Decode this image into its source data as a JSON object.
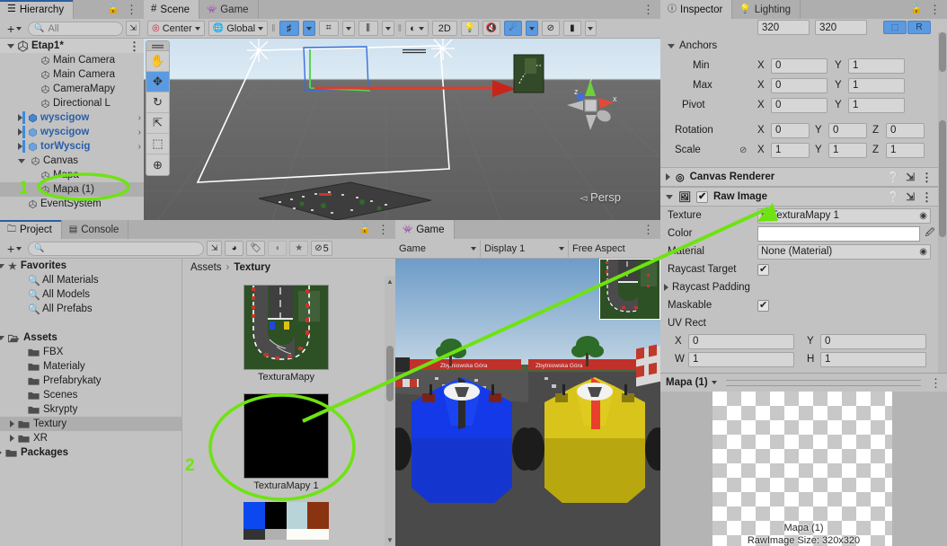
{
  "hierarchy": {
    "tab_label": "Hierarchy",
    "icons": {
      "tab": "hierarchy-icon",
      "lock": "lock-icon",
      "menu": "kebab-menu-icon",
      "add": "plus-icon",
      "search": "search-icon",
      "filter": "filter-icon"
    },
    "search_placeholder": "All",
    "scene_name": "Etap1*",
    "items": [
      {
        "label": "Main Camera",
        "indent": 2,
        "icon": "cube-icon",
        "expand": "none",
        "prefab": false,
        "blue": false,
        "selected": false,
        "strip": false
      },
      {
        "label": "Main Camera",
        "indent": 2,
        "icon": "cube-icon",
        "expand": "none",
        "prefab": false,
        "blue": false,
        "selected": false,
        "strip": false
      },
      {
        "label": "CameraMapy",
        "indent": 2,
        "icon": "cube-icon",
        "expand": "none",
        "prefab": false,
        "blue": false,
        "selected": false,
        "strip": false
      },
      {
        "label": "Directional L",
        "indent": 2,
        "icon": "cube-icon",
        "expand": "none",
        "prefab": false,
        "blue": false,
        "selected": false,
        "strip": false
      },
      {
        "label": "wyscigow",
        "indent": 1,
        "icon": "prefab-cube-icon",
        "expand": "collapsed",
        "prefab": true,
        "blue": true,
        "selected": false,
        "strip": true
      },
      {
        "label": "wyscigow",
        "indent": 1,
        "icon": "prefab-variant-icon",
        "expand": "collapsed",
        "prefab": true,
        "blue": true,
        "selected": false,
        "strip": true
      },
      {
        "label": "torWyscig",
        "indent": 1,
        "icon": "prefab-variant-icon",
        "expand": "collapsed",
        "prefab": true,
        "blue": true,
        "selected": false,
        "strip": true
      },
      {
        "label": "Canvas",
        "indent": 1,
        "icon": "cube-icon",
        "expand": "expanded",
        "prefab": false,
        "blue": false,
        "selected": false,
        "strip": false
      },
      {
        "label": "Mapa",
        "indent": 2,
        "icon": "cube-icon",
        "expand": "none",
        "prefab": false,
        "blue": false,
        "selected": false,
        "strip": false
      },
      {
        "label": "Mapa (1)",
        "indent": 2,
        "icon": "cube-icon",
        "expand": "none",
        "prefab": false,
        "blue": false,
        "selected": true,
        "strip": false
      },
      {
        "label": "EventSystem",
        "indent": 1,
        "icon": "cube-icon",
        "expand": "none",
        "prefab": false,
        "blue": false,
        "selected": false,
        "strip": false
      }
    ]
  },
  "scene": {
    "tabs": [
      {
        "label": "Scene",
        "icon": "grid-hash-icon",
        "active": true
      },
      {
        "label": "Game",
        "icon": "gamepad-icon",
        "active": false
      }
    ],
    "toolbar": {
      "pivot_label": "Center",
      "pivot_icon": "pivot-center-icon",
      "space_label": "Global",
      "space_icon": "globe-icon",
      "grid_icon": "grid-axis-y-icon",
      "snap_icon": "grid-snap-icon",
      "ruler_icon": "ruler-icon",
      "shading_icon": "shading-sphere-icon",
      "toggle_2d_label": "2D",
      "light_icon": "light-off-icon",
      "audio_icon": "audio-mute-icon",
      "fx_icon": "effects-icon",
      "hidden_icon": "visibility-off-icon",
      "camera_icon": "scene-camera-icon",
      "grid_active": true,
      "fx_active": true
    },
    "tools": [
      {
        "name": "hand-tool",
        "icon": "hand-icon",
        "active": false
      },
      {
        "name": "move-tool",
        "icon": "move-icon",
        "active": true
      },
      {
        "name": "rotate-tool",
        "icon": "rotate-icon",
        "active": false
      },
      {
        "name": "scale-tool",
        "icon": "scale-icon",
        "active": false
      },
      {
        "name": "rect-tool",
        "icon": "rect-icon",
        "active": false
      },
      {
        "name": "transform-tool",
        "icon": "transform-icon",
        "active": false
      }
    ],
    "gizmo": {
      "x_label": "x",
      "y_label": "y",
      "z_label": "z"
    },
    "projection_label": "Persp"
  },
  "project": {
    "tabs": [
      {
        "label": "Project",
        "icon": "folder-icon",
        "active": true
      },
      {
        "label": "Console",
        "icon": "console-icon",
        "active": false
      }
    ],
    "icons": {
      "lock": "lock-icon",
      "menu": "kebab-menu-icon",
      "add": "plus-icon",
      "search": "search-icon",
      "save_search": "save-search-icon",
      "packages": "package-filter-icon",
      "label": "label-filter-icon",
      "type": "type-filter-icon",
      "favorite": "star-icon",
      "hidden": "visibility-off-icon"
    },
    "hidden_count": "5",
    "search_placeholder": "",
    "tree": [
      {
        "label": "Favorites",
        "indent": 0,
        "icon": "star-icon",
        "expand": "expanded",
        "bold": true,
        "selected": false
      },
      {
        "label": "All Materials",
        "indent": 1,
        "icon": "search-icon",
        "expand": "none",
        "bold": false,
        "selected": false
      },
      {
        "label": "All Models",
        "indent": 1,
        "icon": "search-icon",
        "expand": "none",
        "bold": false,
        "selected": false
      },
      {
        "label": "All Prefabs",
        "indent": 1,
        "icon": "search-icon",
        "expand": "none",
        "bold": false,
        "selected": false
      },
      {
        "label": "",
        "indent": 0,
        "icon": "none",
        "expand": "none",
        "bold": false,
        "selected": false
      },
      {
        "label": "Assets",
        "indent": 0,
        "icon": "folder-open-icon",
        "expand": "expanded",
        "bold": true,
        "selected": false
      },
      {
        "label": "FBX",
        "indent": 1,
        "icon": "folder-icon",
        "expand": "none",
        "bold": false,
        "selected": false
      },
      {
        "label": "Materialy",
        "indent": 1,
        "icon": "folder-icon",
        "expand": "none",
        "bold": false,
        "selected": false
      },
      {
        "label": "Prefabrykaty",
        "indent": 1,
        "icon": "folder-icon",
        "expand": "none",
        "bold": false,
        "selected": false
      },
      {
        "label": "Scenes",
        "indent": 1,
        "icon": "folder-icon",
        "expand": "none",
        "bold": false,
        "selected": false
      },
      {
        "label": "Skrypty",
        "indent": 1,
        "icon": "folder-icon",
        "expand": "none",
        "bold": false,
        "selected": false
      },
      {
        "label": "Textury",
        "indent": 1,
        "icon": "folder-icon",
        "expand": "collapsed",
        "bold": false,
        "selected": true
      },
      {
        "label": "XR",
        "indent": 1,
        "icon": "folder-icon",
        "expand": "collapsed",
        "bold": false,
        "selected": false
      },
      {
        "label": "Packages",
        "indent": 0,
        "icon": "folder-icon",
        "expand": "collapsed",
        "bold": true,
        "selected": false
      }
    ],
    "breadcrumb": {
      "root": "Assets",
      "separator": "›",
      "current": "Textury"
    },
    "assets": [
      {
        "name": "TexturaMapy",
        "kind": "track-texture"
      },
      {
        "name": "TexturaMapy 1",
        "kind": "black-texture"
      }
    ],
    "swatches": [
      "#0b48ef",
      "#000000",
      "#b8d4d8",
      "#8a3310"
    ]
  },
  "game": {
    "tabs": [
      {
        "label": "Game",
        "icon": "gamepad-icon",
        "active": true
      }
    ],
    "menu_icon": "kebab-menu-icon",
    "toolbar": {
      "mode_label": "Game",
      "display_label": "Display 1",
      "aspect_label": "Free Aspect"
    },
    "banner_text": "Zbytniowska Góra",
    "cars": [
      {
        "player": 1,
        "color": "#1339e8"
      },
      {
        "player": 2,
        "color": "#d8c41a"
      }
    ]
  },
  "inspector": {
    "tabs": [
      {
        "label": "Inspector",
        "icon": "info-icon",
        "active": true
      },
      {
        "label": "Lighting",
        "icon": "light-icon",
        "active": false
      }
    ],
    "icons": {
      "lock": "lock-icon",
      "menu": "kebab-menu-icon",
      "help": "help-icon",
      "preset": "preset-icon"
    },
    "rect_transform_cut": {
      "width_value": "320",
      "height_value": "320",
      "blueprint_icon": "blueprint-mode-icon",
      "raw_label": "R"
    },
    "anchors": {
      "label": "Anchors",
      "min": {
        "label": "Min",
        "x_label": "X",
        "x": "0",
        "y_label": "Y",
        "y": "1"
      },
      "max": {
        "label": "Max",
        "x_label": "X",
        "x": "0",
        "y_label": "Y",
        "y": "1"
      },
      "pivot": {
        "label": "Pivot",
        "x_label": "X",
        "x": "0",
        "y_label": "Y",
        "y": "1"
      }
    },
    "rotation": {
      "label": "Rotation",
      "x_label": "X",
      "x": "0",
      "y_label": "Y",
      "y": "0",
      "z_label": "Z",
      "z": "0"
    },
    "scale": {
      "label": "Scale",
      "link_icon": "link-off-icon",
      "x_label": "X",
      "x": "1",
      "y_label": "Y",
      "y": "1",
      "z_label": "Z",
      "z": "1"
    },
    "components": [
      {
        "name": "Canvas Renderer",
        "icon": "canvas-renderer-icon",
        "expanded": false,
        "has_checkbox": false
      },
      {
        "name": "Raw Image",
        "icon": "raw-image-icon",
        "expanded": true,
        "has_checkbox": true,
        "checked": true
      }
    ],
    "raw_image": {
      "texture": {
        "label": "Texture",
        "value": "TexturaMapy 1",
        "icon": "texture-icon"
      },
      "color": {
        "label": "Color",
        "value_hex": "#ffffff",
        "picker_icon": "eyedropper-icon"
      },
      "material": {
        "label": "Material",
        "value": "None (Material)"
      },
      "raycast_target": {
        "label": "Raycast Target",
        "checked": true
      },
      "raycast_padding": {
        "label": "Raycast Padding",
        "expanded": false
      },
      "maskable": {
        "label": "Maskable",
        "checked": true
      },
      "uv_rect": {
        "label": "UV Rect",
        "x_label": "X",
        "x": "0",
        "y_label": "Y",
        "y": "0",
        "w_label": "W",
        "w": "1",
        "h_label": "H",
        "h": "1"
      }
    },
    "preview": {
      "object_label": "Mapa (1)",
      "caption": "Mapa (1)",
      "caption2": "RawImage Size: 320x320",
      "menu_icon": "kebab-menu-icon"
    }
  },
  "annotations": {
    "accent_color": "#6fe312",
    "marks": [
      {
        "id": "1",
        "label": "1",
        "target": "hierarchy-item-mapa-1"
      },
      {
        "id": "2",
        "label": "2",
        "target": "asset-texturamapy-1"
      }
    ]
  }
}
